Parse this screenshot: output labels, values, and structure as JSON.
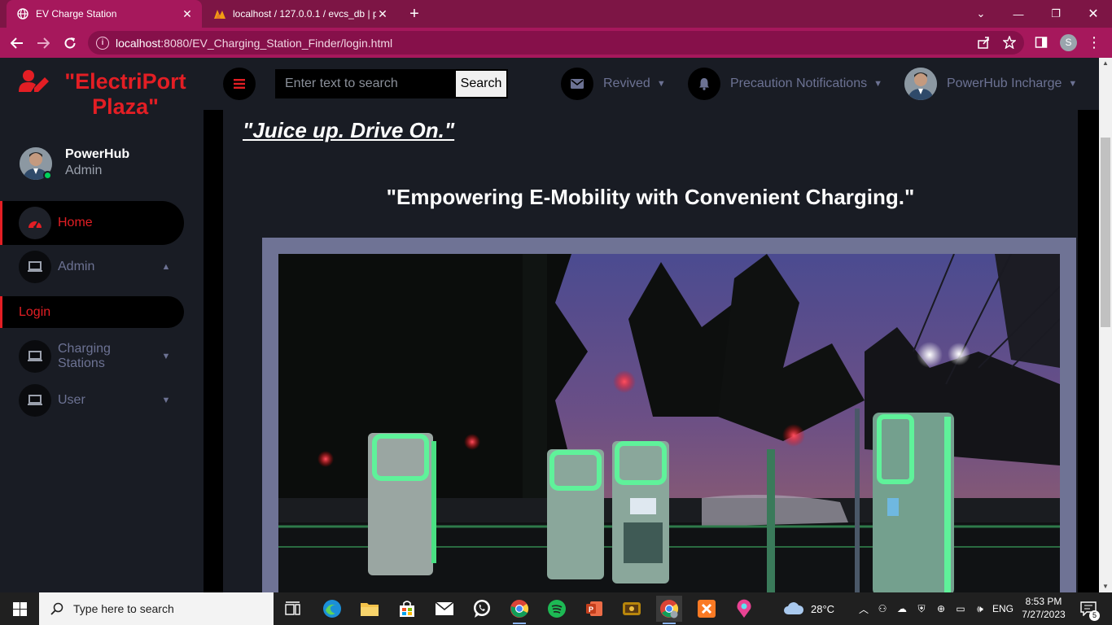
{
  "browser": {
    "tabs": [
      {
        "title": "EV Charge Station",
        "active": true
      },
      {
        "title": "localhost / 127.0.0.1 / evcs_db | p",
        "active": false
      }
    ],
    "url_host": "localhost",
    "url_rest": ":8080/EV_Charging_Station_Finder/login.html",
    "profile_letter": "S"
  },
  "sidebar": {
    "brand": "\"ElectriPort Plaza\"",
    "profile": {
      "name": "PowerHub",
      "role": "Admin"
    },
    "items": [
      {
        "label": "Home",
        "icon": "speedometer-icon",
        "active": true
      },
      {
        "label": "Admin",
        "icon": "laptop-icon",
        "caret": "up"
      },
      {
        "label": "Login",
        "active": true
      },
      {
        "label": "Charging Stations",
        "icon": "laptop-icon",
        "caret": "down"
      },
      {
        "label": "User",
        "icon": "laptop-icon",
        "caret": "down"
      }
    ]
  },
  "topbar": {
    "search_placeholder": "Enter text to search",
    "search_button": "Search",
    "messages_label": "Revived",
    "notifications_label": "Precaution Notifications",
    "user_label": "PowerHub Incharge"
  },
  "content": {
    "tagline": "\"Juice up. Drive On.\"",
    "headline": "\"Empowering E-Mobility with Convenient Charging.\""
  },
  "taskbar": {
    "search_placeholder": "Type here to search",
    "weather": "28°C",
    "language": "ENG",
    "time": "8:53 PM",
    "date": "7/27/2023",
    "notification_count": "5"
  },
  "colors": {
    "chrome_tab_bar": "#7d1545",
    "chrome_toolbar": "#a6185c",
    "brand_red": "#e31e24",
    "panel_bg": "#191c24"
  }
}
